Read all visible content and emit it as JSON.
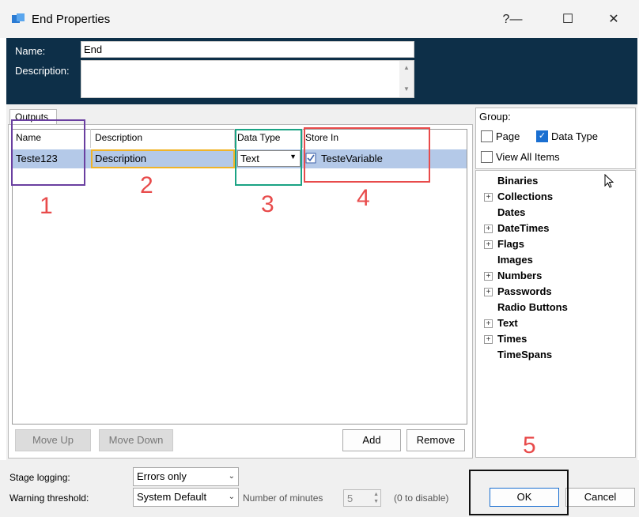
{
  "window": {
    "title": "End Properties",
    "help_glyph": "?",
    "minimize_glyph": "—",
    "maximize_glyph": "☐",
    "close_glyph": "✕"
  },
  "header": {
    "name_label": "Name:",
    "name_value": "End",
    "description_label": "Description:",
    "description_value": ""
  },
  "outputs": {
    "tab_label": "Outputs",
    "columns": [
      "Name",
      "Description",
      "Data Type",
      "Store In"
    ],
    "rows": [
      {
        "name": "Teste123",
        "description": "Description",
        "data_type": "Text",
        "store_in": "TesteVariable"
      }
    ],
    "move_up_label": "Move Up",
    "move_down_label": "Move Down",
    "add_label": "Add",
    "remove_label": "Remove"
  },
  "group": {
    "label": "Group:",
    "page_label": "Page",
    "page_checked": false,
    "data_type_label": "Data Type",
    "data_type_checked": true,
    "view_all_label": "View All Items",
    "view_all_checked": false
  },
  "tree": {
    "items": [
      {
        "label": "Binaries",
        "expandable": false
      },
      {
        "label": "Collections",
        "expandable": true
      },
      {
        "label": "Dates",
        "expandable": false
      },
      {
        "label": "DateTimes",
        "expandable": true
      },
      {
        "label": "Flags",
        "expandable": true
      },
      {
        "label": "Images",
        "expandable": false
      },
      {
        "label": "Numbers",
        "expandable": true
      },
      {
        "label": "Passwords",
        "expandable": true
      },
      {
        "label": "Radio Buttons",
        "expandable": false
      },
      {
        "label": "Text",
        "expandable": true
      },
      {
        "label": "Times",
        "expandable": true
      },
      {
        "label": "TimeSpans",
        "expandable": false
      }
    ]
  },
  "footer": {
    "stage_logging_label": "Stage logging:",
    "stage_logging_value": "Errors only",
    "warning_threshold_label": "Warning threshold:",
    "warning_threshold_value": "System Default",
    "minutes_label": "Number of minutes",
    "minutes_value": "5",
    "disable_hint": "(0 to disable)",
    "ok_label": "OK",
    "cancel_label": "Cancel"
  },
  "annotations": {
    "numbers": [
      "1",
      "2",
      "3",
      "4",
      "5"
    ],
    "colors": {
      "name_box": "#6a3fa0",
      "description_box": "#f0b429",
      "data_type_box": "#1aa384",
      "store_in_box": "#e84b4b",
      "ok_box": "#111111",
      "numbers": "#e84b4b"
    }
  },
  "colors": {
    "header_bg": "#0d2f48",
    "selected_row": "#b4c9e8",
    "checkbox_accent": "#1a6fd1"
  }
}
